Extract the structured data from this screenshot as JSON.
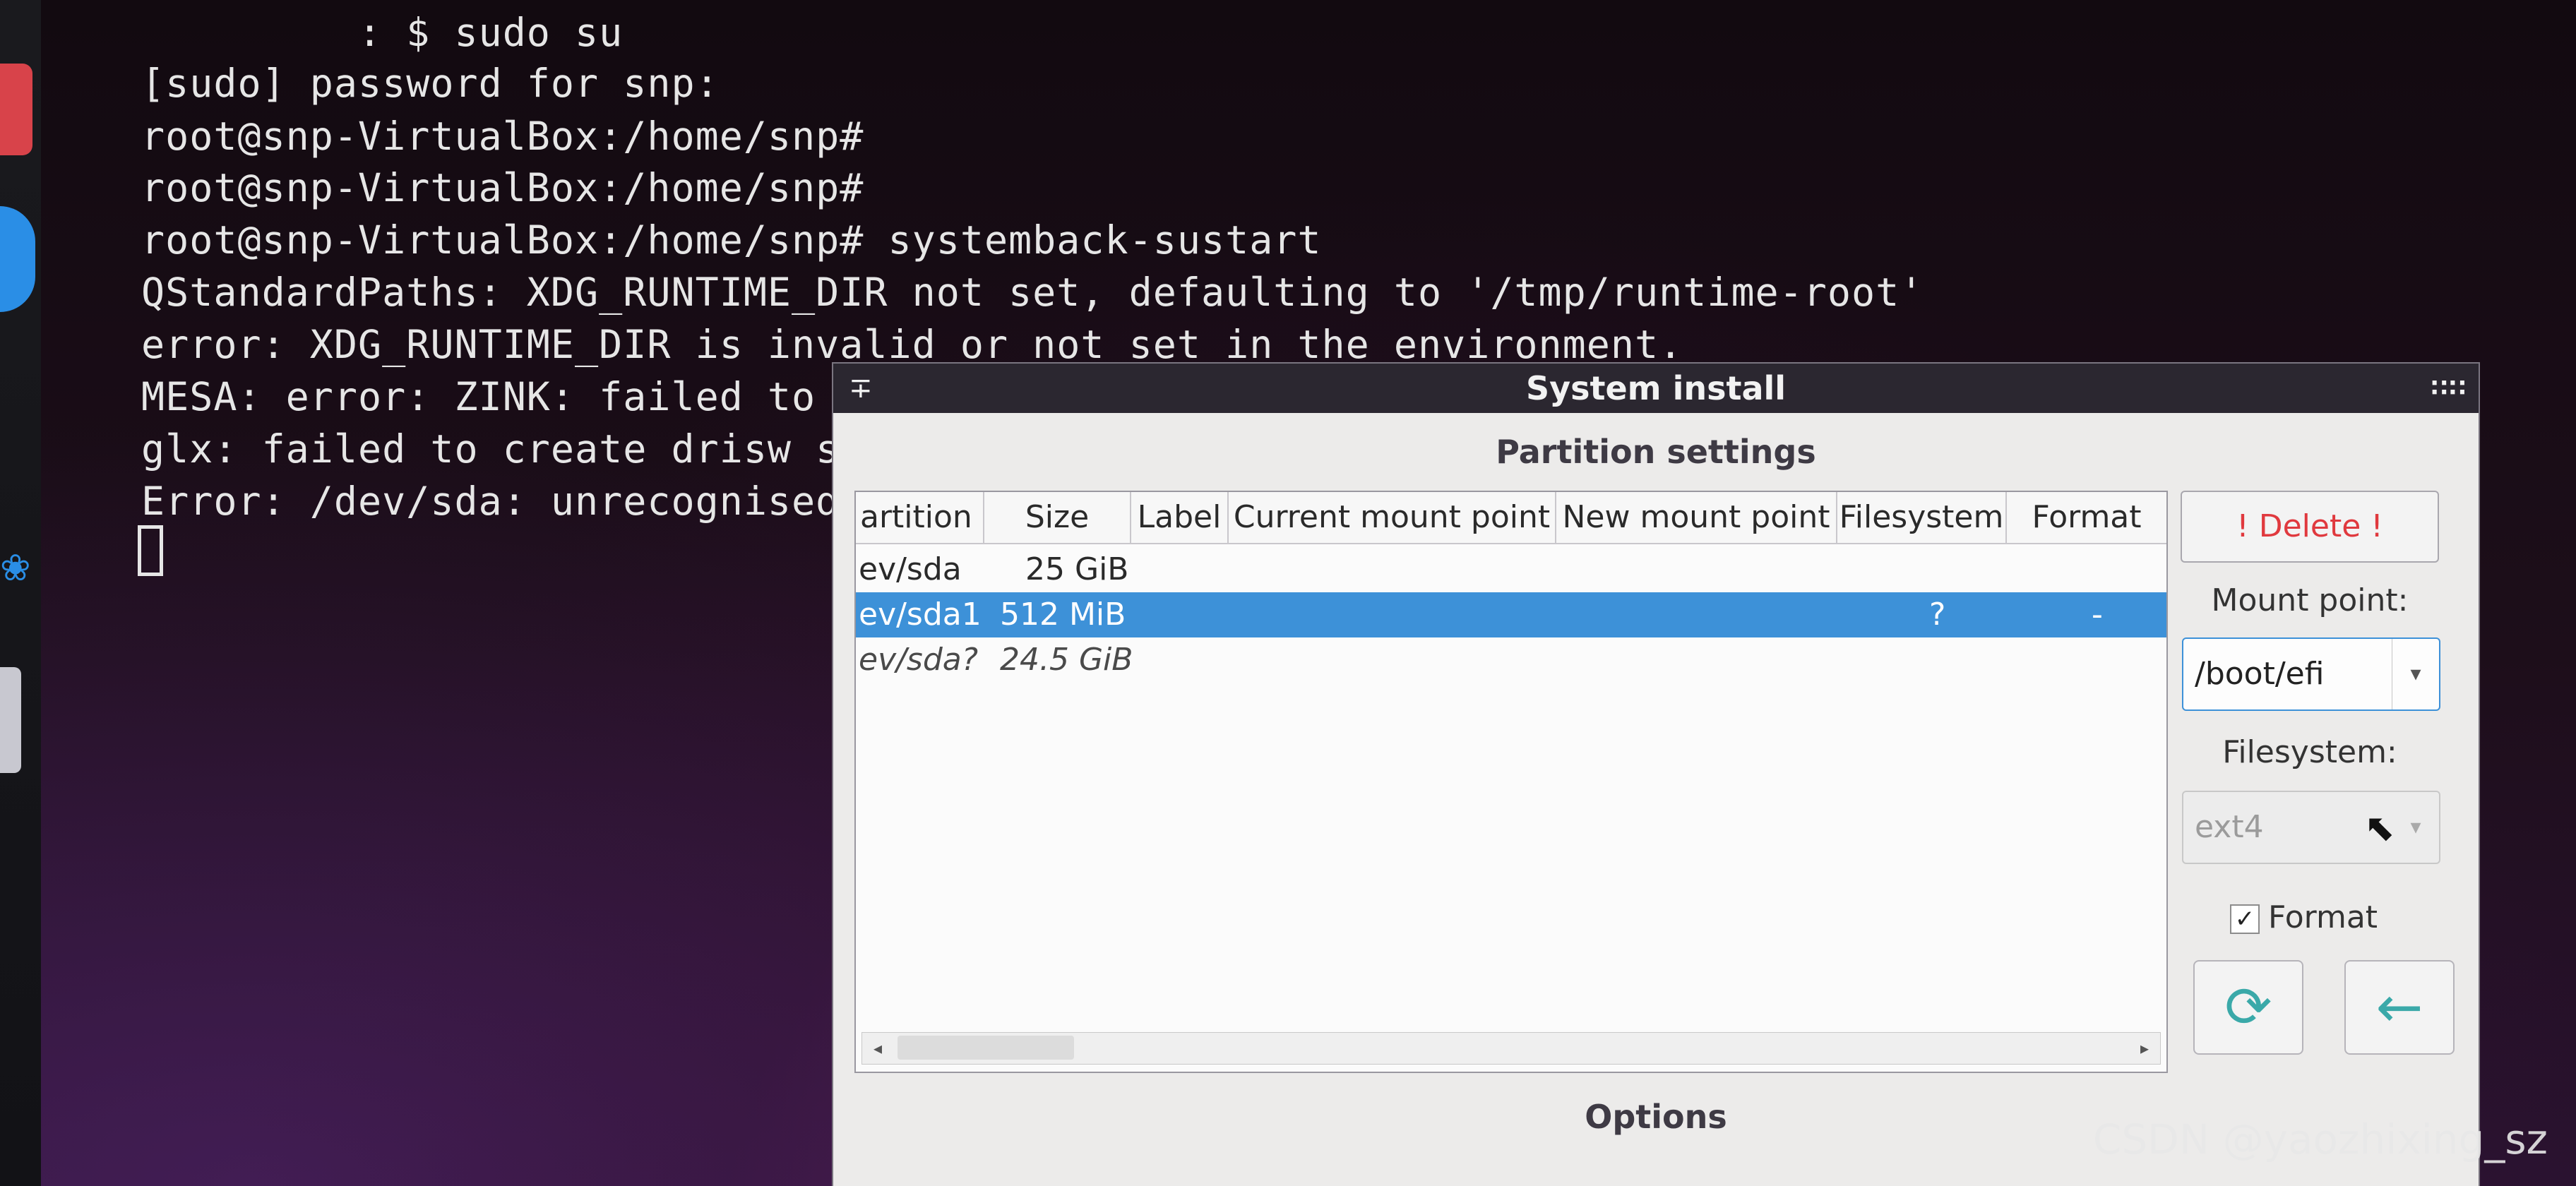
{
  "terminal": {
    "lines": [
      "         : $ sudo su",
      "[sudo] password for snp:",
      "root@snp-VirtualBox:/home/snp#",
      "root@snp-VirtualBox:/home/snp#",
      "root@snp-VirtualBox:/home/snp# systemback-sustart",
      "QStandardPaths: XDG_RUNTIME_DIR not set, defaulting to '/tmp/runtime-root'",
      "error: XDG_RUNTIME_DIR is invalid or not set in the environment.",
      "MESA: error: ZINK: failed to",
      "glx: failed to create drisw s",
      "Error: /dev/sda: unrecognised"
    ]
  },
  "window": {
    "title": "System install",
    "pin_icon": "pin-icon",
    "menu_icon": "grip-icon",
    "partition_settings_title": "Partition settings",
    "options_title": "Options"
  },
  "table": {
    "columns": [
      "artition",
      "Size",
      "Label",
      "Current mount point",
      "New mount point",
      "Filesystem",
      "Format"
    ],
    "rows": [
      {
        "partition": "ev/sda",
        "size": "25 GiB",
        "label": "",
        "current": "",
        "new": "",
        "filesystem": "",
        "format": "",
        "selected": false,
        "italic": false
      },
      {
        "partition": "ev/sda1",
        "size": "512 MiB",
        "label": "",
        "current": "",
        "new": "",
        "filesystem": "?",
        "format": "-",
        "selected": true,
        "italic": false
      },
      {
        "partition": "ev/sda?",
        "size": "24.5 GiB",
        "label": "",
        "current": "",
        "new": "",
        "filesystem": "",
        "format": "",
        "selected": false,
        "italic": true
      }
    ]
  },
  "panel": {
    "delete_label": "! Delete !",
    "mount_point_label": "Mount point:",
    "mount_point_value": "/boot/efi",
    "filesystem_label": "Filesystem:",
    "filesystem_value": "ext4",
    "format_label": "Format",
    "format_checked": true
  },
  "watermark": "CSDN @yaozhixing_sz",
  "colors": {
    "selection": "#3d91d8",
    "delete_text": "#e0393e",
    "titlebar": "#2b2730",
    "window_bg": "#ecebea"
  }
}
